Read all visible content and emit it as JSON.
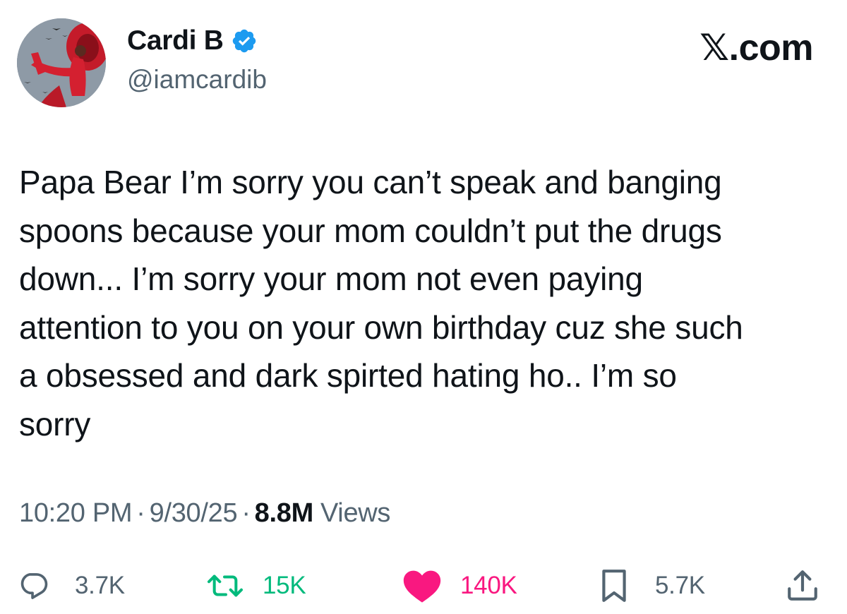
{
  "author": {
    "display_name": "Cardi B",
    "handle": "@iamcardib",
    "verified": true,
    "avatar_icon": "profile-photo"
  },
  "site": {
    "logo_text": ".com",
    "logo_letter": "𝕏"
  },
  "tweet": {
    "text": "Papa Bear I’m sorry you can’t speak and banging\nspoons because your mom couldn’t put the drugs\ndown... I’m sorry your mom not even paying\nattention to you on your own birthday cuz she such\na obsessed and dark spirted hating ho.. I’m so\nsorry"
  },
  "meta": {
    "time": "10:20 PM",
    "date": "9/30/25",
    "separator": "·",
    "views_count": "8.8M",
    "views_label": "Views"
  },
  "actions": {
    "replies": {
      "icon": "reply-icon",
      "count": "3.7K"
    },
    "reposts": {
      "icon": "repost-icon",
      "count": "15K",
      "color": "#00ba7c"
    },
    "likes": {
      "icon": "heart-icon",
      "count": "140K",
      "color": "#f91880"
    },
    "bookmarks": {
      "icon": "bookmark-icon",
      "count": "5.7K"
    },
    "share": {
      "icon": "share-icon"
    }
  },
  "colors": {
    "text": "#0f1419",
    "secondary": "#536471",
    "verified": "#1d9bf0",
    "repost": "#00ba7c",
    "like": "#f91880"
  }
}
